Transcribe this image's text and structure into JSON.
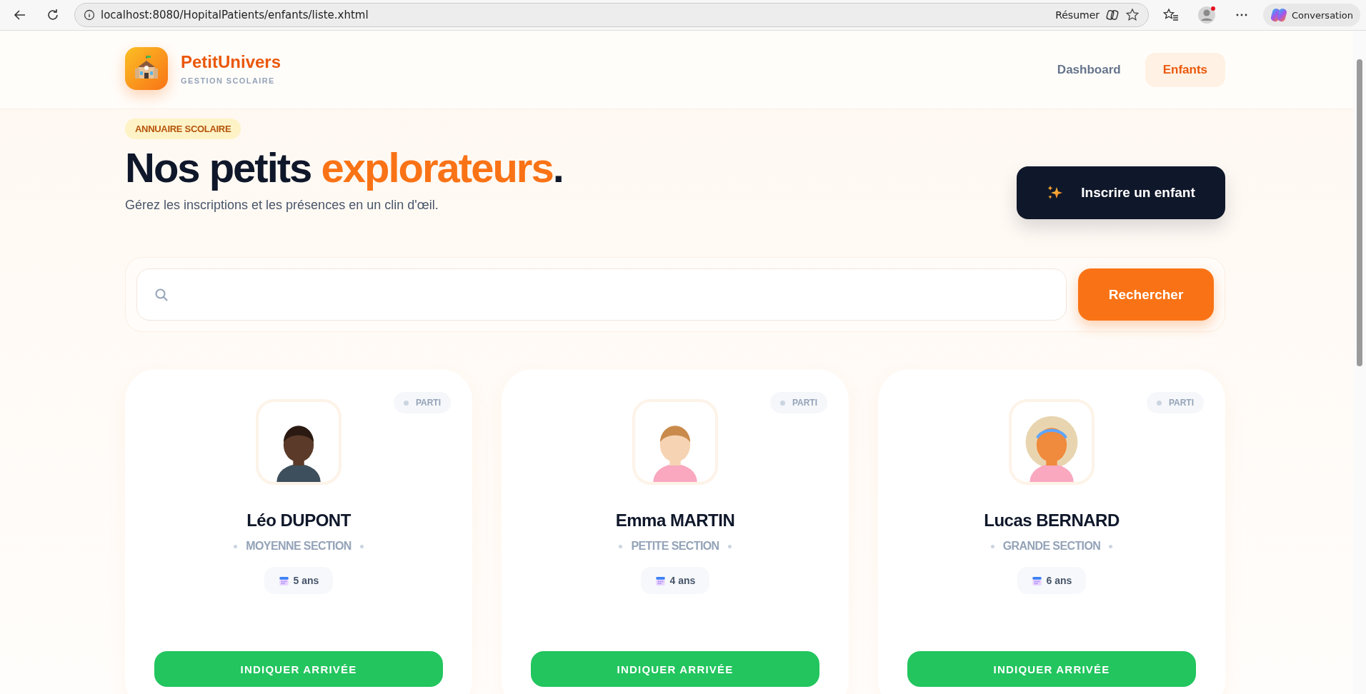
{
  "browser": {
    "url": "localhost:8080/HopitalPatients/enfants/liste.xhtml",
    "summarize": "Résumer",
    "copilot": "Conversation"
  },
  "brand": {
    "name": "PetitUnivers",
    "tagline": "GESTION SCOLAIRE"
  },
  "nav": [
    {
      "label": "Dashboard",
      "selected": false
    },
    {
      "label": "Enfants",
      "selected": true
    }
  ],
  "hero": {
    "badge": "ANNUAIRE SCOLAIRE",
    "title_start": "Nos petits",
    "title_highlight": "explorateurs",
    "title_end": ".",
    "subtitle": "Gérez les inscriptions et les présences en un clin d'œil.",
    "cta": "Inscrire un enfant"
  },
  "search": {
    "button": "Rechercher"
  },
  "children": [
    {
      "name": "Léo DUPONT",
      "section": "MOYENNE SECTION",
      "age": "5 ans",
      "status": "PARTI",
      "action": "INDIQUER ARRIVÉE"
    },
    {
      "name": "Emma MARTIN",
      "section": "PETITE SECTION",
      "age": "4 ans",
      "status": "PARTI",
      "action": "INDIQUER ARRIVÉE"
    },
    {
      "name": "Lucas BERNARD",
      "section": "GRANDE SECTION",
      "age": "6 ans",
      "status": "PARTI",
      "action": "INDIQUER ARRIVÉE"
    }
  ]
}
